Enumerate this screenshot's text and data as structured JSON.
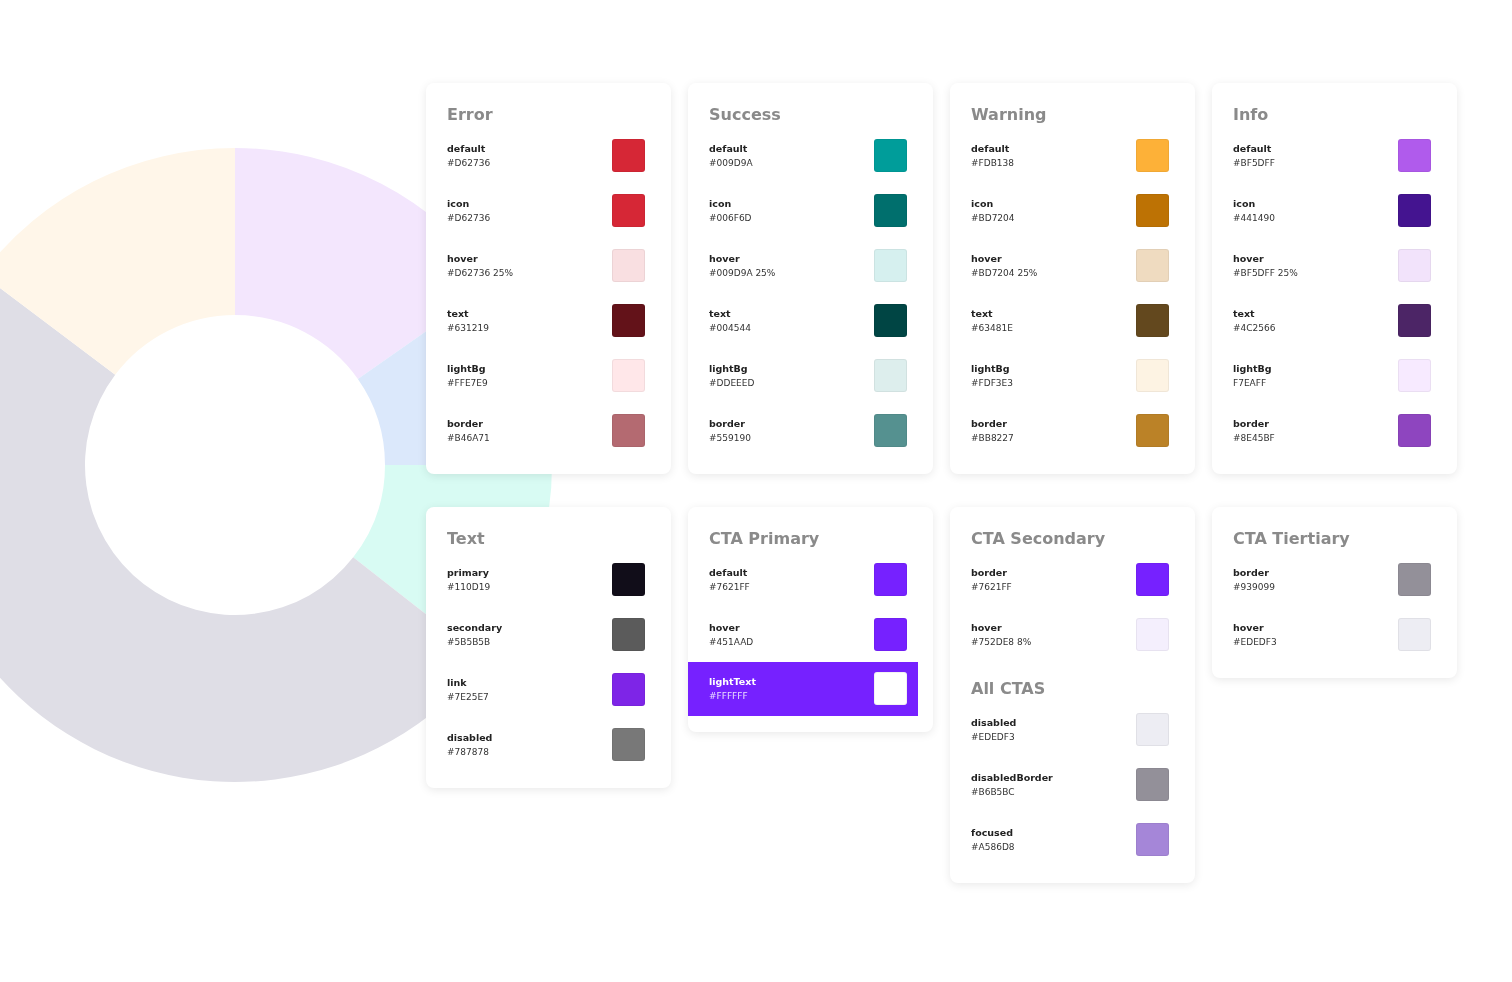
{
  "cards": [
    {
      "sections": [
        {
          "title": "Error",
          "swatches": [
            {
              "kind": "plain",
              "name": "default",
              "hex": "#D62736",
              "color": "#d62736"
            },
            {
              "kind": "plain",
              "name": "icon",
              "hex": "#D62736",
              "color": "#d62736"
            },
            {
              "kind": "plain",
              "name": "hover",
              "hex": "#D62736 25%",
              "color": "#f9dfe1"
            },
            {
              "kind": "plain",
              "name": "text",
              "hex": "#631219",
              "color": "#631219"
            },
            {
              "kind": "plain",
              "name": "lightBg",
              "hex": "#FFE7E9",
              "color": "#ffe7e9"
            },
            {
              "kind": "plain",
              "name": "border",
              "hex": "#B46A71",
              "color": "#b46a71"
            }
          ]
        }
      ]
    },
    {
      "sections": [
        {
          "title": "Success",
          "swatches": [
            {
              "kind": "plain",
              "name": "default",
              "hex": "#009D9A",
              "color": "#009d9a"
            },
            {
              "kind": "plain",
              "name": "icon",
              "hex": "#006F6D",
              "color": "#006f6d"
            },
            {
              "kind": "plain",
              "name": "hover",
              "hex": "#009D9A 25%",
              "color": "#d6f0ef"
            },
            {
              "kind": "plain",
              "name": "text",
              "hex": "#004544",
              "color": "#004544"
            },
            {
              "kind": "plain",
              "name": "lightBg",
              "hex": "#DDEEED",
              "color": "#ddeeed"
            },
            {
              "kind": "plain",
              "name": "border",
              "hex": "#559190",
              "color": "#559190"
            }
          ]
        }
      ]
    },
    {
      "sections": [
        {
          "title": "Warning",
          "swatches": [
            {
              "kind": "plain",
              "name": "default",
              "hex": "#FDB138",
              "color": "#fdb138"
            },
            {
              "kind": "plain",
              "name": "icon",
              "hex": "#BD7204",
              "color": "#bd7204"
            },
            {
              "kind": "plain",
              "name": "hover",
              "hex": "#BD7204 25%",
              "color": "#efdbc0"
            },
            {
              "kind": "plain",
              "name": "text",
              "hex": "#63481E",
              "color": "#63481e"
            },
            {
              "kind": "plain",
              "name": "lightBg",
              "hex": "#FDF3E3",
              "color": "#fdf3e3"
            },
            {
              "kind": "plain",
              "name": "border",
              "hex": "#BB8227",
              "color": "#bb8227"
            }
          ]
        }
      ]
    },
    {
      "sections": [
        {
          "title": "Info",
          "swatches": [
            {
              "kind": "plain",
              "name": "default",
              "hex": "#BF5DFF",
              "color": "#b05bec"
            },
            {
              "kind": "plain",
              "name": "icon",
              "hex": "#441490",
              "color": "#441490"
            },
            {
              "kind": "plain",
              "name": "hover",
              "hex": "#BF5DFF 25%",
              "color": "#f2e3fb"
            },
            {
              "kind": "plain",
              "name": "text",
              "hex": "#4C2566",
              "color": "#4c2566"
            },
            {
              "kind": "plain",
              "name": "lightBg",
              "hex": "F7EAFF",
              "color": "#f7eaff"
            },
            {
              "kind": "plain",
              "name": "border",
              "hex": "#8E45BF",
              "color": "#8e45bf"
            }
          ]
        }
      ]
    },
    {
      "sections": [
        {
          "title": "Text",
          "swatches": [
            {
              "kind": "plain",
              "name": "primary",
              "hex": "#110D19",
              "color": "#110d19"
            },
            {
              "kind": "plain",
              "name": "secondary",
              "hex": "#5B5B5B",
              "color": "#5b5b5b"
            },
            {
              "kind": "plain",
              "name": "link",
              "hex": "#7E25E7",
              "color": "#7e25e7"
            },
            {
              "kind": "plain",
              "name": "disabled",
              "hex": "#787878",
              "color": "#787878"
            }
          ]
        }
      ]
    },
    {
      "sections": [
        {
          "title": "CTA Primary",
          "swatches": [
            {
              "kind": "plain",
              "name": "default",
              "hex": "#7621FF",
              "color": "#7621ff"
            },
            {
              "kind": "plain",
              "name": "hover",
              "hex": "#451AAD",
              "color": "#7621ff"
            },
            {
              "kind": "inverse",
              "name": "lightText",
              "hex": "#FFFFFF",
              "color": "#ffffff"
            }
          ]
        }
      ]
    },
    {
      "sections": [
        {
          "title": "CTA Secondary",
          "swatches": [
            {
              "kind": "plain",
              "name": "border",
              "hex": "#7621FF",
              "color": "#7621ff"
            },
            {
              "kind": "plain",
              "name": "hover",
              "hex": "#752DE8 8%",
              "color": "#f4effd"
            }
          ]
        },
        {
          "title": "All CTAS",
          "swatches": [
            {
              "kind": "plain",
              "name": "disabled",
              "hex": "#EDEDF3",
              "color": "#ededf3"
            },
            {
              "kind": "plain",
              "name": "disabledBorder",
              "hex": "#B6B5BC",
              "color": "#939099"
            },
            {
              "kind": "plain",
              "name": "focused",
              "hex": "#A586D8",
              "color": "#a586d8"
            }
          ]
        }
      ]
    },
    {
      "sections": [
        {
          "title": "CTA Tiertiary",
          "swatches": [
            {
              "kind": "plain",
              "name": "border",
              "hex": "#939099",
              "color": "#939099"
            },
            {
              "kind": "plain",
              "name": "hover",
              "hex": "#EDEDF3",
              "color": "#ededf3"
            }
          ]
        }
      ]
    }
  ]
}
